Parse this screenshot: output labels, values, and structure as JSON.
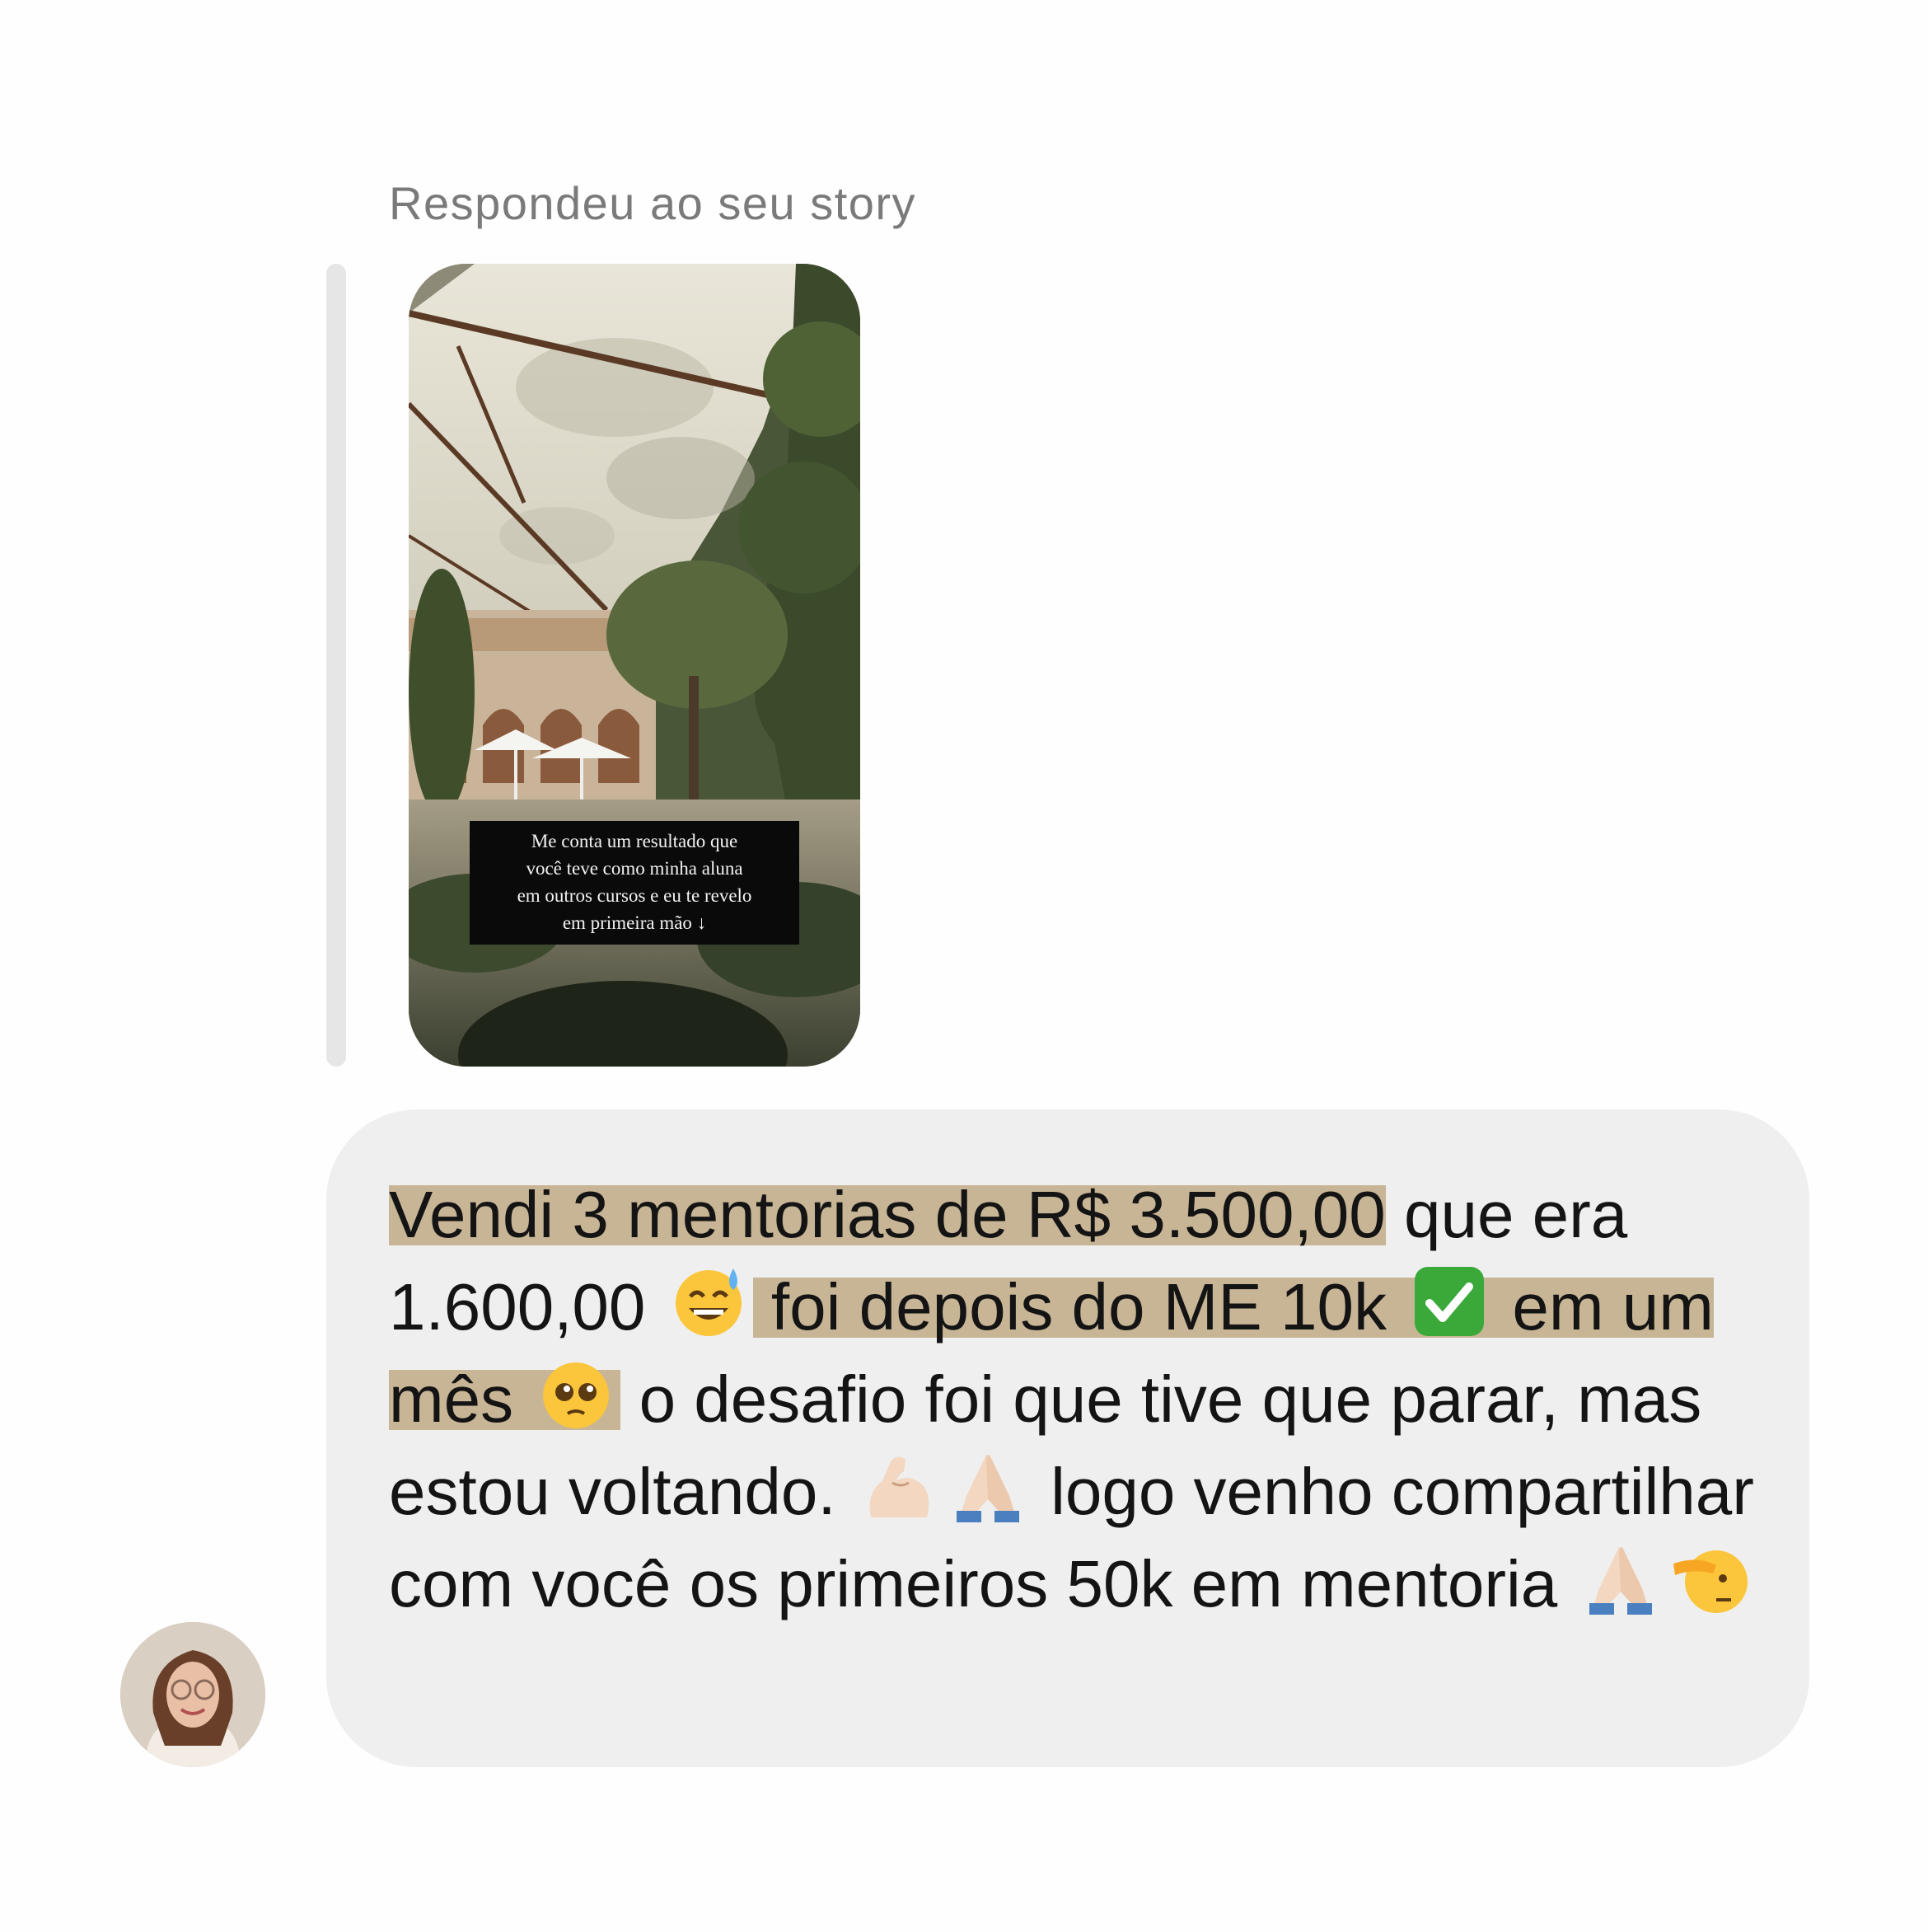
{
  "reply_label": "Respondeu ao seu story",
  "story": {
    "caption": "Me conta um resultado que você teve como minha aluna em outros cursos e eu te revelo em primeira mão ↓",
    "caption_lines": [
      "Me conta um resultado que",
      "você teve como minha aluna",
      "em outros cursos e eu te revelo",
      "em primeira mão ↓"
    ]
  },
  "message": {
    "segments": {
      "s1": "Vendi 3 mentorias de R$ 3.500,00",
      "s2": " que era 1.600,00 ",
      "e1": "sweat-smile-emoji",
      "s3": " foi depois do ME 10k ",
      "e2": "check-mark-button-emoji",
      "s4": " em um mês ",
      "e3": "pleading-face-emoji",
      "s5": " o desafio foi que tive que parar, mas estou voltando. ",
      "e4": "flexed-biceps-emoji",
      "e5": "folded-hands-emoji",
      "s6": " logo venho compartilhar com você os primeiros 50k em mentoria ",
      "e6": "folded-hands-emoji",
      "e7": "saluting-face-emoji"
    },
    "highlight_color": "#c8b596"
  },
  "colors": {
    "bubble": "#efefef",
    "label": "#7a7a7a",
    "text": "#141414"
  },
  "avatar": {
    "icon": "user-avatar"
  }
}
